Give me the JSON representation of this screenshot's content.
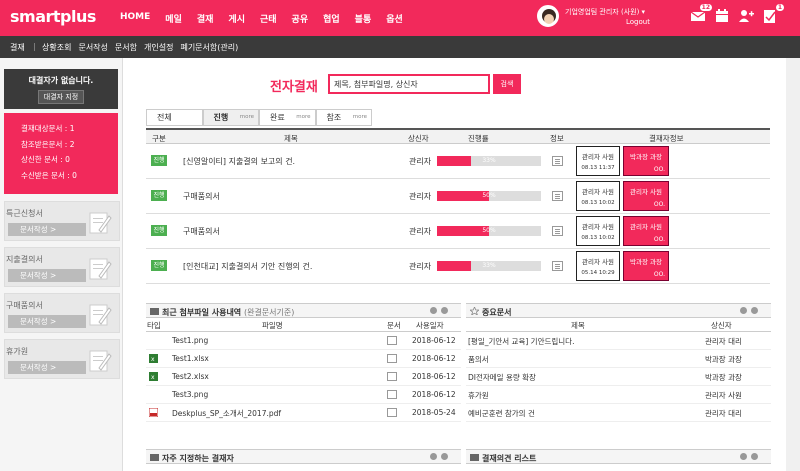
{
  "brand": "smartplus",
  "nav": [
    "HOME",
    "메일",
    "결재",
    "게시",
    "근태",
    "공유",
    "협업",
    "블통",
    "옵션"
  ],
  "user": {
    "name": "기업영업팀 관리자 (사원)",
    "logout": "Logout"
  },
  "top_badges": {
    "mail": "12",
    "alert": "1"
  },
  "subbar": {
    "crumb": "결재",
    "items": [
      "상황조회",
      "문서작성",
      "문서함",
      "개인설정",
      "폐기문서함(관리)"
    ]
  },
  "left": {
    "no_approver": "대결자가 없습니다.",
    "set_approver": "대결자 지정",
    "stats": [
      "결재대상문서 : 1",
      "참조받은문서 : 2",
      "상신한 문서 : 0",
      "수신받은 문서 : 0"
    ],
    "forms": [
      {
        "name": "특근신청서",
        "btn": "문서작성 >"
      },
      {
        "name": "지출결의서",
        "btn": "문서작성 >"
      },
      {
        "name": "구매품의서",
        "btn": "문서작성 >"
      },
      {
        "name": "휴가원",
        "btn": "문서작성 >"
      }
    ]
  },
  "title": "전자결재",
  "search": {
    "value": "제목, 첨부파일명, 상신자",
    "btn": "검색"
  },
  "tabs": [
    {
      "label": "전체",
      "more": ""
    },
    {
      "label": "진행",
      "more": "more"
    },
    {
      "label": "완료",
      "more": "more"
    },
    {
      "label": "참조",
      "more": "more"
    }
  ],
  "grid": {
    "headers": [
      "구분",
      "제목",
      "상신자",
      "진행률",
      "정보",
      "결재자정보"
    ],
    "rows": [
      {
        "status": "진행",
        "subject": "[신영알이티] 지출결의 보고의 건.",
        "drafter": "관리자",
        "progress": 33,
        "pct": "33%",
        "signer": "관리자 사원",
        "date": "08.13 11:37",
        "pending": "박과장 과장",
        "dots": "OO."
      },
      {
        "status": "진행",
        "subject": "구매품의서",
        "drafter": "관리자",
        "progress": 50,
        "pct": "50%",
        "signer": "관리자 사원",
        "date": "08.13 10:02",
        "pending": "관리자 사원",
        "dots": "OO."
      },
      {
        "status": "진행",
        "subject": "구매품의서",
        "drafter": "관리자",
        "progress": 50,
        "pct": "50%",
        "signer": "관리자 사원",
        "date": "08.13 10:02",
        "pending": "관리자 사원",
        "dots": "OO."
      },
      {
        "status": "진행",
        "subject": "[인천대교] 지출결의서 기안 진행의 건.",
        "drafter": "관리자",
        "progress": 33,
        "pct": "33%",
        "signer": "관리자 사원",
        "date": "05.14 10:29",
        "pending": "박과장 과장",
        "dots": "OO."
      }
    ]
  },
  "files_panel": {
    "title": "최근 첨부파일 사용내역",
    "sub": "(완결문서기준)",
    "headers": [
      "타입",
      "파일명",
      "문서",
      "사용일자"
    ],
    "rows": [
      {
        "type": "png",
        "name": "Test1.png",
        "date": "2018-06-12"
      },
      {
        "type": "xlsx",
        "name": "Test1.xlsx",
        "date": "2018-06-12"
      },
      {
        "type": "xlsx",
        "name": "Test2.xlsx",
        "date": "2018-06-12"
      },
      {
        "type": "png",
        "name": "Test3.png",
        "date": "2018-06-12"
      },
      {
        "type": "pdf",
        "name": "Deskplus_SP_소개서_2017.pdf",
        "date": "2018-05-24"
      }
    ]
  },
  "important_panel": {
    "title": "중요문서",
    "headers": [
      "제목",
      "상신자"
    ],
    "rows": [
      {
        "title": "[평일_기안서 교육] 기안드립니다.",
        "drafter": "관리자 대리"
      },
      {
        "title": "품의서",
        "drafter": "박과장 과장"
      },
      {
        "title": "DI전자메일 용량 확장",
        "drafter": "박과장 과장"
      },
      {
        "title": "휴가원",
        "drafter": "관리자 사원"
      },
      {
        "title": "예비군훈련 참가의 건",
        "drafter": "관리자 대리"
      }
    ]
  },
  "bottom_panels": [
    "자주 지정하는 결재자",
    "결재의견 리스트"
  ],
  "colors": {
    "accent": "#f2295b",
    "dark": "#3a3a3a",
    "status": "#4caf50"
  }
}
